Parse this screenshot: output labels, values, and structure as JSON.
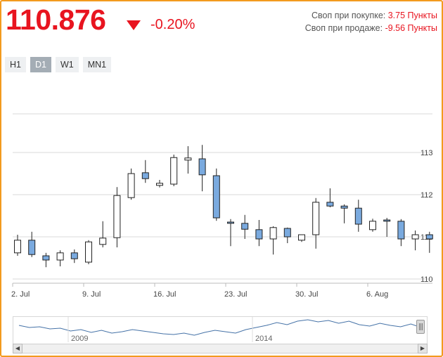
{
  "quote": {
    "price": "110.876",
    "change": "-0.20%",
    "swap_buy_label": "Своп при покупке:",
    "swap_buy_value": "3.75 Пункты",
    "swap_sell_label": "Своп при продаже:",
    "swap_sell_value": "-9.56 Пункты",
    "direction_icon": "triangle-down-icon",
    "color_down": "#e8141f"
  },
  "tabs": [
    {
      "label": "H1",
      "active": false
    },
    {
      "label": "D1",
      "active": true
    },
    {
      "label": "W1",
      "active": false
    },
    {
      "label": "MN1",
      "active": false
    }
  ],
  "chart_data": {
    "type": "candlestick",
    "ylim": [
      110,
      113.5
    ],
    "y_ticks": [
      "110",
      "111",
      "112",
      "113"
    ],
    "x_tick_labels": [
      {
        "label": "2. Jul",
        "index": 0
      },
      {
        "label": "9. Jul",
        "index": 5
      },
      {
        "label": "16. Jul",
        "index": 10
      },
      {
        "label": "23. Jul",
        "index": 15
      },
      {
        "label": "30. Jul",
        "index": 20
      },
      {
        "label": "6. Aug",
        "index": 25
      }
    ],
    "colors": {
      "up": "#ffffff",
      "down": "#7aaadf",
      "outline": "#222222",
      "grid": "#d9d9d9"
    },
    "candles": [
      {
        "o": 110.62,
        "h": 111.05,
        "l": 110.55,
        "c": 110.92
      },
      {
        "o": 110.92,
        "h": 111.12,
        "l": 110.52,
        "c": 110.58
      },
      {
        "o": 110.55,
        "h": 110.62,
        "l": 110.28,
        "c": 110.45
      },
      {
        "o": 110.45,
        "h": 110.68,
        "l": 110.3,
        "c": 110.62
      },
      {
        "o": 110.62,
        "h": 110.7,
        "l": 110.38,
        "c": 110.48
      },
      {
        "o": 110.4,
        "h": 110.92,
        "l": 110.35,
        "c": 110.88
      },
      {
        "o": 110.82,
        "h": 111.37,
        "l": 110.75,
        "c": 110.97
      },
      {
        "o": 110.98,
        "h": 112.18,
        "l": 110.75,
        "c": 111.98
      },
      {
        "o": 111.93,
        "h": 112.62,
        "l": 111.88,
        "c": 112.5
      },
      {
        "o": 112.52,
        "h": 112.82,
        "l": 112.28,
        "c": 112.38
      },
      {
        "o": 112.22,
        "h": 112.35,
        "l": 112.17,
        "c": 112.27
      },
      {
        "o": 112.25,
        "h": 112.95,
        "l": 112.2,
        "c": 112.88
      },
      {
        "o": 112.82,
        "h": 113.15,
        "l": 112.5,
        "c": 112.87
      },
      {
        "o": 112.85,
        "h": 113.18,
        "l": 112.08,
        "c": 112.47
      },
      {
        "o": 112.45,
        "h": 112.62,
        "l": 111.38,
        "c": 111.45
      },
      {
        "o": 111.35,
        "h": 111.42,
        "l": 110.78,
        "c": 111.32
      },
      {
        "o": 111.32,
        "h": 111.52,
        "l": 110.95,
        "c": 111.18
      },
      {
        "o": 111.17,
        "h": 111.4,
        "l": 110.78,
        "c": 110.95
      },
      {
        "o": 110.95,
        "h": 111.25,
        "l": 110.58,
        "c": 111.22
      },
      {
        "o": 111.2,
        "h": 111.22,
        "l": 110.85,
        "c": 111.0
      },
      {
        "o": 110.92,
        "h": 111.05,
        "l": 110.88,
        "c": 111.05
      },
      {
        "o": 111.05,
        "h": 111.92,
        "l": 110.72,
        "c": 111.82
      },
      {
        "o": 111.82,
        "h": 112.15,
        "l": 111.7,
        "c": 111.73
      },
      {
        "o": 111.73,
        "h": 111.77,
        "l": 111.32,
        "c": 111.68
      },
      {
        "o": 111.68,
        "h": 111.88,
        "l": 111.12,
        "c": 111.3
      },
      {
        "o": 111.17,
        "h": 111.43,
        "l": 111.12,
        "c": 111.37
      },
      {
        "o": 111.4,
        "h": 111.45,
        "l": 111.0,
        "c": 111.37
      },
      {
        "o": 111.37,
        "h": 111.42,
        "l": 110.78,
        "c": 110.95
      },
      {
        "o": 110.95,
        "h": 111.15,
        "l": 110.68,
        "c": 111.05
      },
      {
        "o": 111.05,
        "h": 111.12,
        "l": 110.62,
        "c": 110.95
      }
    ]
  },
  "navigator": {
    "labels": [
      "2009",
      "2014"
    ],
    "series": [
      111.2,
      110.9,
      111.0,
      110.7,
      110.8,
      110.4,
      110.6,
      110.2,
      110.5,
      110.1,
      110.3,
      110.6,
      110.4,
      110.2,
      110.0,
      109.9,
      110.1,
      109.8,
      110.2,
      110.5,
      110.3,
      110.1,
      110.6,
      110.9,
      111.2,
      111.6,
      111.3,
      111.8,
      112.0,
      111.7,
      111.9,
      111.5,
      111.8,
      111.3,
      111.1,
      111.5,
      111.2,
      111.0,
      111.4,
      110.9
    ]
  }
}
